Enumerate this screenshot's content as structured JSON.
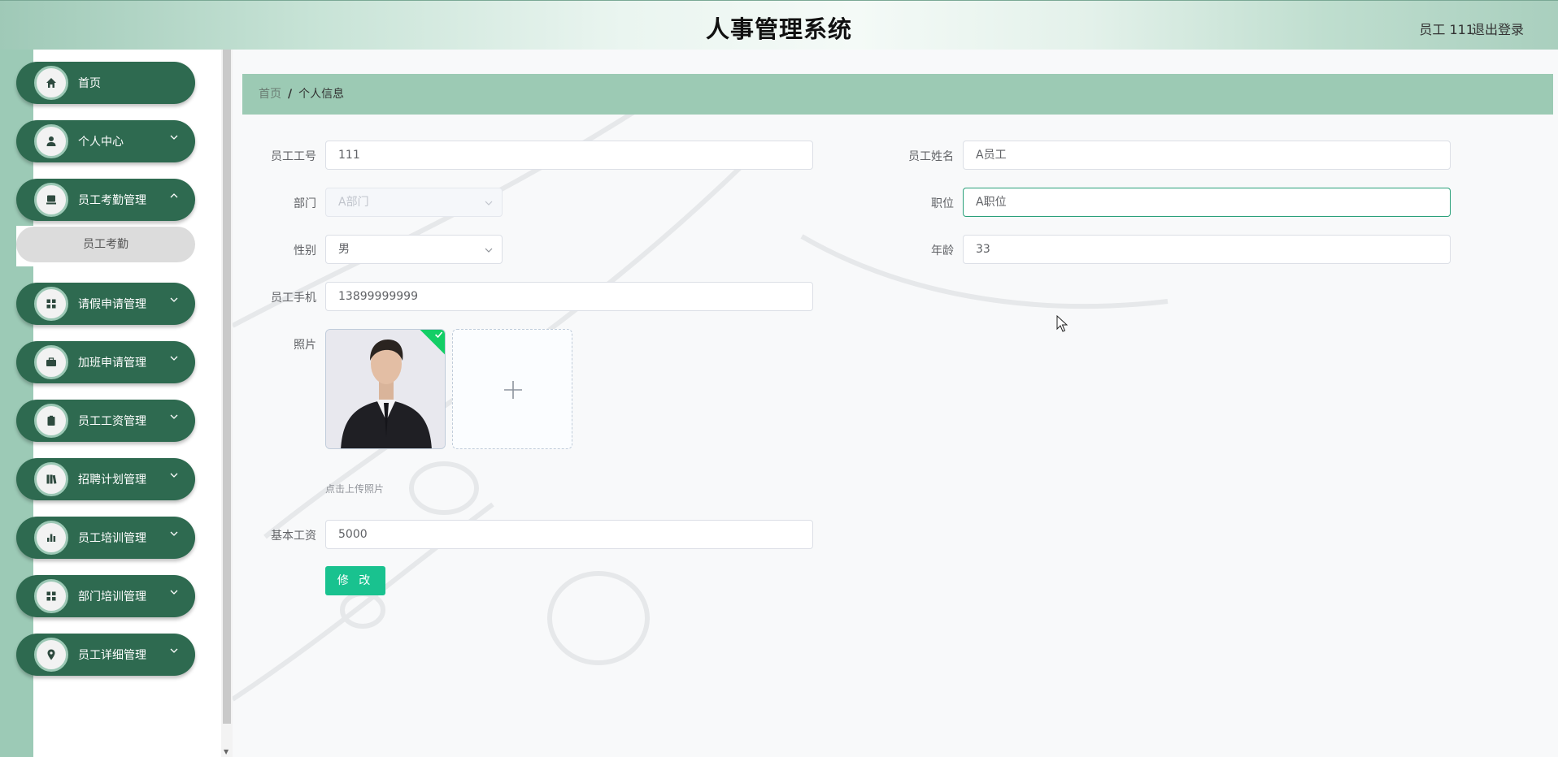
{
  "header": {
    "title": "人事管理系统",
    "user": "员工 111",
    "logout": "退出登录"
  },
  "sidebar": {
    "items": [
      {
        "label": "首页",
        "icon": "home-icon",
        "expandable": false
      },
      {
        "label": "个人中心",
        "icon": "user-icon",
        "expandable": true
      },
      {
        "label": "员工考勤管理",
        "icon": "monitor-icon",
        "expandable": true
      },
      {
        "label": "请假申请管理",
        "icon": "grid-icon",
        "expandable": true
      },
      {
        "label": "加班申请管理",
        "icon": "briefcase-icon",
        "expandable": true
      },
      {
        "label": "员工工资管理",
        "icon": "clipboard-icon",
        "expandable": true
      },
      {
        "label": "招聘计划管理",
        "icon": "book-icon",
        "expandable": true
      },
      {
        "label": "员工培训管理",
        "icon": "bar-chart-icon",
        "expandable": true
      },
      {
        "label": "部门培训管理",
        "icon": "grid-icon",
        "expandable": true
      },
      {
        "label": "员工详细管理",
        "icon": "location-icon",
        "expandable": true
      }
    ],
    "submenu": {
      "label": "员工考勤"
    }
  },
  "breadcrumb": {
    "home": "首页",
    "separator": "/",
    "current": "个人信息"
  },
  "form": {
    "employee_no": {
      "label": "员工工号",
      "value": "111"
    },
    "employee_name": {
      "label": "员工姓名",
      "value": "A员工"
    },
    "department": {
      "label": "部门",
      "value": "A部门"
    },
    "position": {
      "label": "职位",
      "value": "A职位"
    },
    "gender": {
      "label": "性别",
      "value": "男"
    },
    "age": {
      "label": "年龄",
      "value": "33"
    },
    "phone": {
      "label": "员工手机",
      "value": "13899999999"
    },
    "photo": {
      "label": "照片",
      "hint": "点击上传照片"
    },
    "base_salary": {
      "label": "基本工资",
      "value": "5000"
    },
    "submit_label": "修 改"
  },
  "colors": {
    "menu_bg": "#2e6a50",
    "rail": "#9ccab6",
    "breadcrumb_bg": "#9ccab4",
    "button": "#19c28f",
    "upload_success": "#13ce66"
  }
}
